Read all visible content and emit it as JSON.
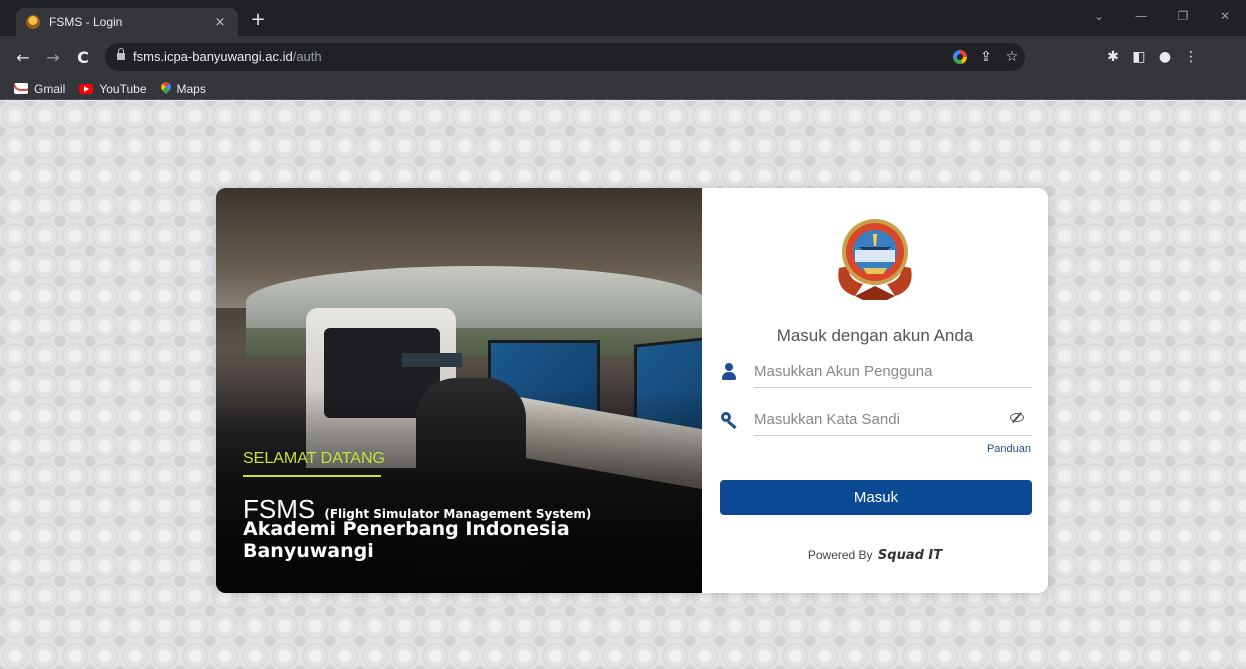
{
  "browser": {
    "tab_title": "FSMS - Login",
    "tab_close": "×",
    "new_tab": "+",
    "url_host": "fsms.icpa-banyuwangi.ac.id",
    "url_path": "/auth",
    "bookmarks": [
      {
        "label": "Gmail",
        "icon": "gmail-icon"
      },
      {
        "label": "YouTube",
        "icon": "youtube-icon"
      },
      {
        "label": "Maps",
        "icon": "maps-icon"
      }
    ]
  },
  "hero": {
    "welcome": "SELAMAT DATANG",
    "app_abbr": "FSMS",
    "app_full": "(Flight Simulator Management System)",
    "academy": "Akademi Penerbang Indonesia Banyuwangi"
  },
  "login": {
    "heading": "Masuk dengan akun Anda",
    "username_placeholder": "Masukkan Akun Pengguna",
    "password_placeholder": "Masukkan Kata Sandi",
    "guide_link": "Panduan",
    "submit_label": "Masuk",
    "powered_by": "Powered By",
    "brand": "Squad IT"
  },
  "colors": {
    "primary": "#0d4a96",
    "accent_green": "#c6e33a",
    "icon_blue": "#1e4f91"
  }
}
